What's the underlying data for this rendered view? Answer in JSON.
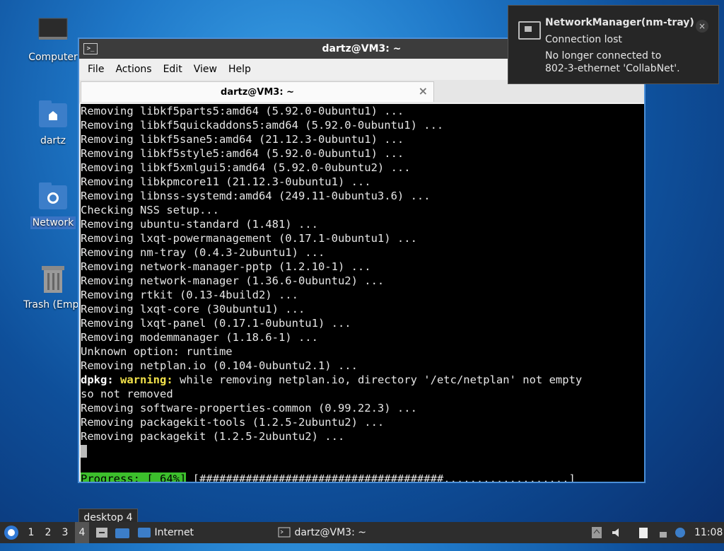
{
  "desktop": {
    "icons": [
      {
        "label": "Computer",
        "icon": "monitor-icon"
      },
      {
        "label": "dartz",
        "icon": "home-folder-icon"
      },
      {
        "label": "Network",
        "icon": "network-folder-icon"
      },
      {
        "label": "Trash (Empt",
        "icon": "trash-icon"
      }
    ]
  },
  "window": {
    "title": "dartz@VM3: ~",
    "menu": [
      "File",
      "Actions",
      "Edit",
      "View",
      "Help"
    ],
    "tab_title": "dartz@VM3: ~",
    "tab_close": "×"
  },
  "terminal": {
    "lines": [
      "Removing libkf5parts5:amd64 (5.92.0-0ubuntu1) ...",
      "Removing libkf5quickaddons5:amd64 (5.92.0-0ubuntu1) ...",
      "Removing libkf5sane5:amd64 (21.12.3-0ubuntu1) ...",
      "Removing libkf5style5:amd64 (5.92.0-0ubuntu1) ...",
      "Removing libkf5xmlgui5:amd64 (5.92.0-0ubuntu2) ...",
      "Removing libkpmcore11 (21.12.3-0ubuntu1) ...",
      "Removing libnss-systemd:amd64 (249.11-0ubuntu3.6) ...",
      "Checking NSS setup...",
      "Removing ubuntu-standard (1.481) ...",
      "Removing lxqt-powermanagement (0.17.1-0ubuntu1) ...",
      "Removing nm-tray (0.4.3-2ubuntu1) ...",
      "Removing network-manager-pptp (1.2.10-1) ...",
      "Removing network-manager (1.36.6-0ubuntu2) ...",
      "Removing rtkit (0.13-4build2) ...",
      "Removing lxqt-core (30ubuntu1) ...",
      "Removing lxqt-panel (0.17.1-0ubuntu1) ...",
      "Removing modemmanager (1.18.6-1) ...",
      "Unknown option: runtime",
      "Removing netplan.io (0.104-0ubuntu2.1) ..."
    ],
    "warn_prefix": "dpkg:",
    "warn_word": "warning:",
    "warn_text": " while removing netplan.io, directory '/etc/netplan' not empty",
    "warn_cont": "so not removed",
    "lines2": [
      "Removing software-properties-common (0.99.22.3) ...",
      "Removing packagekit-tools (1.2.5-2ubuntu2) ...",
      "Removing packagekit (1.2.5-2ubuntu2) ..."
    ],
    "progress_label": "Progress: [ 64%]",
    "progress_bar": " [#####################################...................]",
    "progress_percent": 64
  },
  "notification": {
    "title": "NetworkManager(nm-tray)",
    "subtitle": "Connection lost",
    "body_line1": "No longer connected to",
    "body_line2": "802-3-ethernet 'CollabNet'.",
    "close": "×"
  },
  "tooltip": {
    "text": "desktop 4"
  },
  "taskbar": {
    "desktops": [
      "1",
      "2",
      "3",
      "4"
    ],
    "active_desktop": "4",
    "quicklaunch_label": "Internet",
    "task_title": "dartz@VM3: ~",
    "clock": "11:08"
  }
}
